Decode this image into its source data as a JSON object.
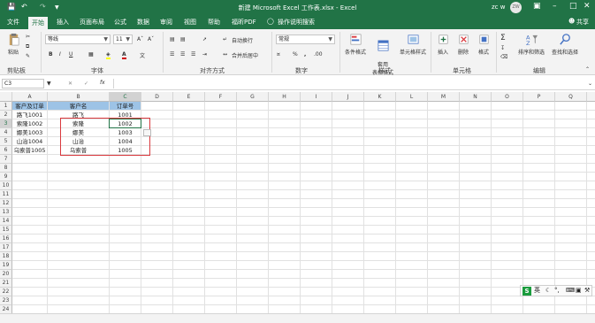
{
  "window": {
    "title": "新建 Microsoft Excel 工作表.xlsx - Excel",
    "user": "zc w",
    "avatar": "ZW"
  },
  "tabs": [
    "文件",
    "开始",
    "插入",
    "页面布局",
    "公式",
    "数据",
    "审阅",
    "视图",
    "帮助",
    "福昕PDF",
    "操作说明搜索",
    "共享"
  ],
  "ribbon": {
    "clipboard": {
      "paste": "粘贴",
      "label": "剪贴板"
    },
    "font": {
      "name": "等线",
      "size": "11",
      "label": "字体",
      "font_color": "#d00000",
      "fill_color": "#ffff00"
    },
    "alignment": {
      "wrap": "自动换行",
      "merge": "合并后居中",
      "label": "对齐方式"
    },
    "number": {
      "format": "常规",
      "label": "数字"
    },
    "styles": {
      "conditional": "条件格式",
      "table": "套用\n表格格式",
      "cell": "单元格样式",
      "label": "样式"
    },
    "cells": {
      "insert": "插入",
      "delete": "删除",
      "format": "格式",
      "label": "单元格"
    },
    "editing": {
      "sort": "排序和筛选",
      "find": "查找和选择",
      "label": "编辑"
    }
  },
  "formula_bar": {
    "name_box": "C3",
    "fx": "fx",
    "value": ""
  },
  "columns": [
    "A",
    "B",
    "C",
    "D",
    "E",
    "F",
    "G",
    "H",
    "I",
    "J",
    "K",
    "L",
    "M",
    "N",
    "O",
    "P",
    "Q",
    "R"
  ],
  "rows": [
    "1",
    "2",
    "3",
    "4",
    "5",
    "6",
    "7",
    "8",
    "9",
    "10",
    "11",
    "12",
    "13",
    "14",
    "15",
    "16",
    "17",
    "18",
    "19",
    "20",
    "21",
    "22",
    "23",
    "24"
  ],
  "selected_cell": "C3",
  "cells": [
    [
      "客户及订单",
      "客户名",
      "订单号"
    ],
    [
      "路飞1001",
      "路飞",
      "1001"
    ],
    [
      "索隆1002",
      "索隆",
      "1002"
    ],
    [
      "娜美1003",
      "娜美",
      "1003"
    ],
    [
      "山治1004",
      "山治",
      "1004"
    ],
    [
      "乌索普1005",
      "乌索普",
      "1005"
    ]
  ],
  "colors": {
    "excel_green": "#217346",
    "header_fill": "#9dc3e6",
    "highlight": "#d9393e"
  },
  "tray": {
    "ime": "英"
  }
}
